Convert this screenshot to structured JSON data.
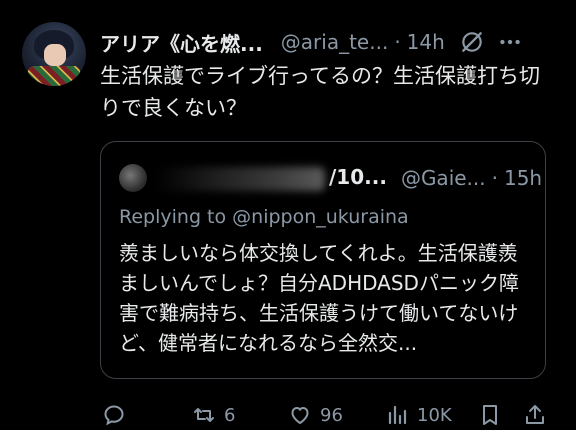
{
  "tweet": {
    "display_name": "アリア《心を燃...",
    "handle": "@aria_te...",
    "separator": "·",
    "time": "14h",
    "text": "生活保護でライブ行ってるの？生活保護打ち切りで良くない？"
  },
  "quote": {
    "display_name_visible": "/10...",
    "handle": "@Gaie...",
    "separator": "·",
    "time": "15h",
    "reply_prefix": "Replying to ",
    "reply_mention": "@nippon_ukuraina",
    "text": "羨ましいなら体交換してくれよ。生活保護羨ましいんでしょ？自分ADHDASDパニック障害で難病持ち、生活保護うけて働いてないけど、健常者になれるなら全然交..."
  },
  "actions": {
    "reply_count": "",
    "retweet_count": "6",
    "like_count": "96",
    "views_count": "10K"
  },
  "icons": [
    "avatar",
    "grok-icon",
    "more-icon",
    "reply-icon",
    "retweet-icon",
    "like-icon",
    "views-icon",
    "bookmark-icon",
    "share-icon"
  ],
  "colors": {
    "background": "#000000",
    "text": "#e7e9ea",
    "secondary": "#8b98a5",
    "border": "#3b4047"
  }
}
